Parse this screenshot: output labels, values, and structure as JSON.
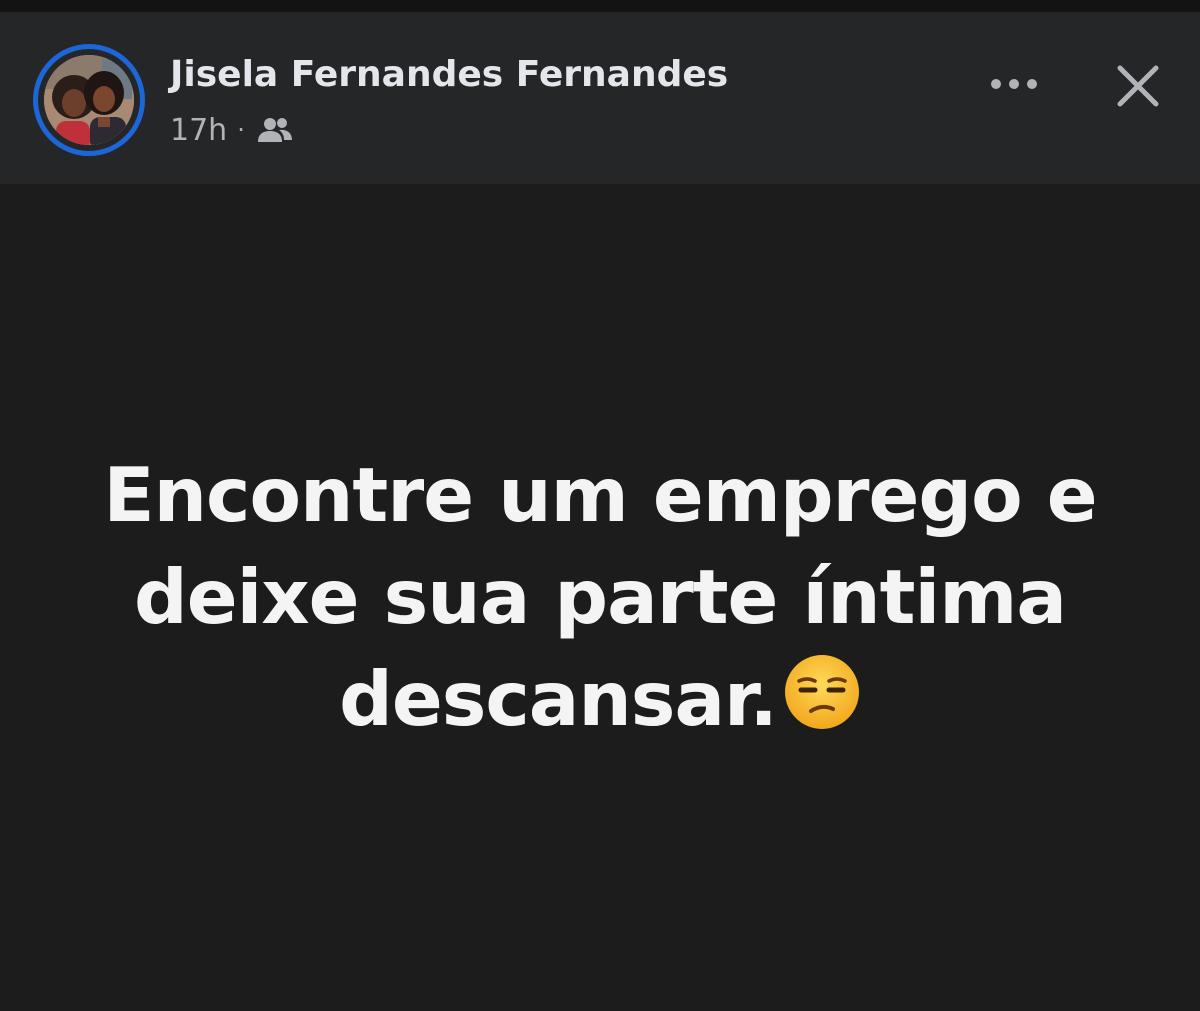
{
  "post": {
    "author_name": "Jisela Fernandes Fernandes",
    "timestamp": "17h",
    "separator": "·",
    "audience_icon": "friends-icon",
    "text": "Encontre um emprego e deixe sua parte íntima descansar.",
    "emoji_icon": "unamused-face-emoji"
  },
  "header": {
    "more_icon": "more-options-icon",
    "close_icon": "close-icon"
  },
  "colors": {
    "header_background": "#252628",
    "body_background": "#1c1c1c",
    "avatar_ring": "#1d66d8",
    "name_text": "#e4e6eb",
    "meta_text": "#b0b3b8",
    "post_text": "#f4f4f4"
  }
}
